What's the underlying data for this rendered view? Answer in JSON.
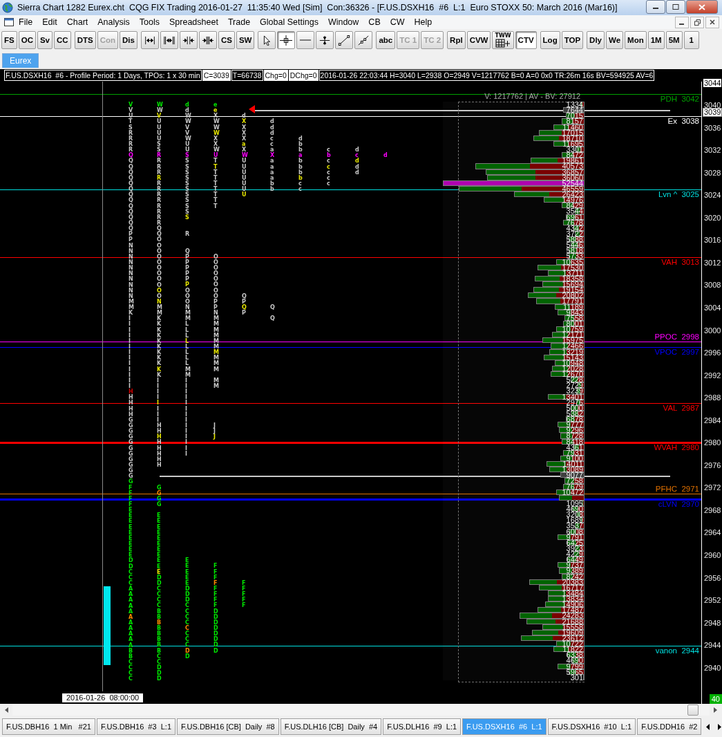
{
  "window": {
    "title": "Sierra Chart 1282 Eurex.cht  CQG FIX Trading 2016-01-27  11:35:40 Wed [Sim]  Con:36326 - [F.US.DSXH16  #6  L:1  Euro STOXX 50: March 2016 (Mar16)]"
  },
  "menu": [
    "File",
    "Edit",
    "Chart",
    "Analysis",
    "Tools",
    "Spreadsheet",
    "Trade",
    "Global Settings",
    "Window",
    "CB",
    "CW",
    "Help"
  ],
  "toolbar": [
    [
      {
        "kind": "text",
        "label": "FS",
        "selected": false,
        "disabled": false
      },
      {
        "kind": "text",
        "label": "OC",
        "selected": false,
        "disabled": false
      },
      {
        "kind": "text",
        "label": "Sv",
        "selected": false,
        "disabled": false
      },
      {
        "kind": "text",
        "label": "CC",
        "selected": false,
        "disabled": false
      }
    ],
    [
      {
        "kind": "text",
        "label": "DTS",
        "selected": false,
        "disabled": false
      },
      {
        "kind": "text",
        "label": "Con",
        "selected": false,
        "disabled": true
      },
      {
        "kind": "text",
        "label": "Dis",
        "selected": false,
        "disabled": false
      }
    ],
    [
      {
        "kind": "icon",
        "selected": false
      },
      {
        "kind": "icon",
        "selected": false
      },
      {
        "kind": "icon",
        "selected": false
      },
      {
        "kind": "icon",
        "selected": false
      },
      {
        "kind": "text",
        "label": "CS",
        "selected": false,
        "disabled": false
      },
      {
        "kind": "text",
        "label": "SW",
        "selected": false,
        "disabled": false
      }
    ],
    [
      {
        "kind": "icon",
        "selected": false
      },
      {
        "kind": "icon",
        "selected": true
      },
      {
        "kind": "icon",
        "selected": false
      },
      {
        "kind": "icon",
        "selected": false
      },
      {
        "kind": "icon",
        "selected": false
      },
      {
        "kind": "icon",
        "selected": false
      }
    ],
    [
      {
        "kind": "text",
        "label": "abc",
        "selected": false,
        "disabled": false
      },
      {
        "kind": "text",
        "label": "TC 1",
        "selected": false,
        "disabled": true
      },
      {
        "kind": "text",
        "label": "TC 2",
        "selected": false,
        "disabled": true
      }
    ],
    [
      {
        "kind": "text",
        "label": "Rpl",
        "selected": false,
        "disabled": false
      },
      {
        "kind": "text",
        "label": "CVW",
        "selected": false,
        "disabled": false
      },
      {
        "kind": "grid",
        "label": "TWW",
        "selected": false
      },
      {
        "kind": "text",
        "label": "CTV",
        "selected": true,
        "disabled": false
      }
    ],
    [
      {
        "kind": "text",
        "label": "Log",
        "selected": false,
        "disabled": false
      },
      {
        "kind": "text",
        "label": "TOP",
        "selected": false,
        "disabled": false
      }
    ],
    [
      {
        "kind": "text",
        "label": "Dly",
        "selected": false,
        "disabled": false
      },
      {
        "kind": "text",
        "label": "We",
        "selected": false,
        "disabled": false
      },
      {
        "kind": "text",
        "label": "Mon",
        "selected": false,
        "disabled": false
      },
      {
        "kind": "text",
        "label": "1M",
        "selected": false,
        "disabled": false
      },
      {
        "kind": "text",
        "label": "5M",
        "selected": false,
        "disabled": false
      },
      {
        "kind": "text",
        "label": "1",
        "selected": false,
        "disabled": false
      }
    ]
  ],
  "chartbook_tabs": [
    {
      "label": "Eurex",
      "selected": true
    }
  ],
  "info_bar": [
    {
      "text": "F.US.DSXH16  #6 - Profile Period: 1 Days, TPOs: 1 x 30 min",
      "boxed": false
    },
    {
      "text": "C=3039",
      "boxed": true
    },
    {
      "text": "T=66738",
      "boxed": false
    },
    {
      "text": "Chg=0",
      "boxed": true
    },
    {
      "text": "DChg=0",
      "boxed": true
    },
    {
      "text": "2016-01-26 22:03:44 H=3040 L=2938 O=2949 V=1217762 B=0 A=0 0x0 TR:26m 16s BV=594925 AV=6",
      "boxed": false
    }
  ],
  "tpo_columns": [
    [
      {
        "kind": "green",
        "text": "V"
      },
      {
        "kind": "grey",
        "text": "VUTSRRRR"
      },
      {
        "kind": "magenta",
        "text": "Q"
      },
      {
        "kind": "grey",
        "text": "QQQQQQQQQQQQQPPNNNNNNNNNNMMKIIIIIIIIIIIII"
      },
      {
        "kind": "red",
        "text": "H"
      },
      {
        "kind": "grey",
        "text": "HHHHGGGGGGGGGGG"
      },
      {
        "kind": "green",
        "text": "GFFFFEEEEEEEEEDDCCCAAAAA"
      },
      {
        "kind": "orange",
        "text": "A"
      },
      {
        "kind": "green",
        "text": "AAAAABBCCCC"
      }
    ],
    [
      {
        "kind": "green",
        "text": "W"
      },
      {
        "kind": "grey",
        "text": "W"
      },
      {
        "kind": "yellow",
        "text": "V"
      },
      {
        "kind": "grey",
        "text": "UUUUSS"
      },
      {
        "kind": "magenta",
        "text": "R"
      },
      {
        "kind": "grey",
        "text": "RRR"
      },
      {
        "kind": "yellow",
        "text": "R"
      },
      {
        "kind": "grey",
        "text": "RRRRRRRRQQOOOOOOOOO"
      },
      {
        "kind": "yellow",
        "text": "O"
      },
      {
        "kind": "grey",
        "text": "O"
      },
      {
        "kind": "yellow",
        "text": "N"
      },
      {
        "kind": "grey",
        "text": "MMKKKKKKKKK"
      },
      {
        "kind": "yellow",
        "text": "K"
      },
      {
        "kind": "grey",
        "text": "KIIII"
      },
      {
        "kind": "yellow",
        "text": "I"
      },
      {
        "kind": "grey",
        "text": "IIIHH"
      },
      {
        "kind": "yellow",
        "text": "H"
      },
      {
        "kind": "grey",
        "text": "HHHHH"
      },
      {
        "kind": "gap",
        "text": "   "
      },
      {
        "kind": "green",
        "text": "G"
      },
      {
        "kind": "orange",
        "text": "G"
      },
      {
        "kind": "green",
        "text": "GG"
      },
      {
        "kind": "gap",
        "text": " "
      },
      {
        "kind": "green",
        "text": "EEEEEEEEEE"
      },
      {
        "kind": "yellow",
        "text": "E"
      },
      {
        "kind": "green",
        "text": "DDCCCCBB"
      },
      {
        "kind": "orange",
        "text": "B"
      },
      {
        "kind": "green",
        "text": "BBBBBCCDDD"
      }
    ],
    [
      {
        "kind": "green",
        "text": "d"
      },
      {
        "kind": "grey",
        "text": "dWWVVWUU"
      },
      {
        "kind": "magenta",
        "text": "S"
      },
      {
        "kind": "grey",
        "text": "SSSSSSSSSS"
      },
      {
        "kind": "yellow",
        "text": "S"
      },
      {
        "kind": "gap",
        "text": "  "
      },
      {
        "kind": "grey",
        "text": "R"
      },
      {
        "kind": "gap",
        "text": "  "
      },
      {
        "kind": "grey",
        "text": "QPPPPP"
      },
      {
        "kind": "yellow",
        "text": "P"
      },
      {
        "kind": "grey",
        "text": "OOONMMLLL"
      },
      {
        "kind": "yellow",
        "text": "L"
      },
      {
        "kind": "grey",
        "text": "LLLLMMIIIIIIIIIIIIII"
      },
      {
        "kind": "gap",
        "text": "                  "
      },
      {
        "kind": "green",
        "text": "EEEEEDDDCCCC"
      },
      {
        "kind": "orange",
        "text": "C"
      },
      {
        "kind": "green",
        "text": "CCC"
      },
      {
        "kind": "orange",
        "text": "D"
      },
      {
        "kind": "green",
        "text": "D"
      }
    ],
    [
      {
        "kind": "green",
        "text": "e"
      },
      {
        "kind": "yellow",
        "text": "e"
      },
      {
        "kind": "grey",
        "text": "XWW"
      },
      {
        "kind": "yellow",
        "text": "W"
      },
      {
        "kind": "grey",
        "text": "XXW"
      },
      {
        "kind": "magenta",
        "text": "U"
      },
      {
        "kind": "grey",
        "text": "T"
      },
      {
        "kind": "yellow",
        "text": "T"
      },
      {
        "kind": "grey",
        "text": "TTTTTTT"
      },
      {
        "kind": "gap",
        "text": "        "
      },
      {
        "kind": "grey",
        "text": "OOOOOOOOPPNMMMMMM"
      },
      {
        "kind": "yellow",
        "text": "M"
      },
      {
        "kind": "grey",
        "text": "MMM"
      },
      {
        "kind": "gap",
        "text": " "
      },
      {
        "kind": "grey",
        "text": "MM"
      },
      {
        "kind": "gap",
        "text": "      "
      },
      {
        "kind": "grey",
        "text": "JJ"
      },
      {
        "kind": "yellow",
        "text": "J"
      },
      {
        "kind": "gap",
        "text": "                      "
      },
      {
        "kind": "green",
        "text": "FFF"
      },
      {
        "kind": "orange",
        "text": "F"
      },
      {
        "kind": "green",
        "text": "FFFFDDDDDDDD"
      }
    ],
    [
      {
        "kind": "gap",
        "text": "  "
      },
      {
        "kind": "grey",
        "text": "d"
      },
      {
        "kind": "yellow",
        "text": "X"
      },
      {
        "kind": "grey",
        "text": "XXX"
      },
      {
        "kind": "yellow",
        "text": "a"
      },
      {
        "kind": "grey",
        "text": "X"
      },
      {
        "kind": "magenta",
        "text": "W"
      },
      {
        "kind": "grey",
        "text": "UUUUUU"
      },
      {
        "kind": "yellow",
        "text": "U"
      },
      {
        "kind": "gap",
        "text": "                 "
      },
      {
        "kind": "grey",
        "text": "QP"
      },
      {
        "kind": "yellow",
        "text": "Q"
      },
      {
        "kind": "grey",
        "text": "P"
      },
      {
        "kind": "gap",
        "text": "                                               "
      },
      {
        "kind": "green",
        "text": "FFFFF"
      }
    ],
    [
      {
        "kind": "gap",
        "text": "   "
      },
      {
        "kind": "grey",
        "text": "dddcca"
      },
      {
        "kind": "magenta",
        "text": "X"
      },
      {
        "kind": "grey",
        "text": "aaaabb"
      },
      {
        "kind": "gap",
        "text": "                    "
      },
      {
        "kind": "grey",
        "text": "Q"
      },
      {
        "kind": "gap",
        "text": " "
      },
      {
        "kind": "grey",
        "text": "Q"
      }
    ],
    [
      {
        "kind": "gap",
        "text": "      "
      },
      {
        "kind": "grey",
        "text": "dbb"
      },
      {
        "kind": "magenta",
        "text": "a"
      },
      {
        "kind": "grey",
        "text": "bbb"
      },
      {
        "kind": "yellow",
        "text": "b"
      },
      {
        "kind": "grey",
        "text": "cc"
      }
    ],
    [
      {
        "kind": "gap",
        "text": "        "
      },
      {
        "kind": "grey",
        "text": "c"
      },
      {
        "kind": "magenta",
        "text": "b"
      },
      {
        "kind": "grey",
        "text": "c"
      },
      {
        "kind": "yellow",
        "text": "c"
      },
      {
        "kind": "grey",
        "text": "ccc"
      }
    ],
    [
      {
        "kind": "gap",
        "text": "        "
      },
      {
        "kind": "grey",
        "text": "d"
      },
      {
        "kind": "magenta",
        "text": "c"
      },
      {
        "kind": "yellow",
        "text": "d"
      },
      {
        "kind": "grey",
        "text": "dd"
      }
    ],
    [
      {
        "kind": "gap",
        "text": "         "
      },
      {
        "kind": "magenta",
        "text": "d"
      }
    ]
  ],
  "profile": {
    "title": "V: 1217762 | AV - BV: 27912",
    "rows": [
      {
        "volume": "1334",
        "kind": "normal",
        "level": 0.03
      },
      {
        "volume": "7644",
        "kind": "last",
        "level": 0.15
      },
      {
        "volume": "7015",
        "kind": "normal",
        "level": 0.13
      },
      {
        "volume": "8157",
        "kind": "normal",
        "level": 0.16
      },
      {
        "volume": "11460",
        "kind": "normal",
        "level": 0.22
      },
      {
        "volume": "17015",
        "kind": "normal",
        "level": 0.32
      },
      {
        "volume": "18710",
        "kind": "normal",
        "level": 0.36
      },
      {
        "volume": "11695",
        "kind": "normal",
        "level": 0.22
      },
      {
        "volume": "3301",
        "kind": "normal",
        "level": 0.06
      },
      {
        "volume": "8472",
        "kind": "normal",
        "level": 0.16
      },
      {
        "volume": "19861",
        "kind": "normal",
        "level": 0.38
      },
      {
        "volume": "40573",
        "kind": "normal",
        "level": 0.77
      },
      {
        "volume": "36857",
        "kind": "normal",
        "level": 0.7
      },
      {
        "volume": "36060",
        "kind": "normal",
        "level": 0.69
      },
      {
        "volume": "52544",
        "kind": "poc",
        "level": 1
      },
      {
        "volume": "46559",
        "kind": "normal",
        "level": 0.89
      },
      {
        "volume": "26423",
        "kind": "normal",
        "level": 0.5
      },
      {
        "volume": "14976",
        "kind": "normal",
        "level": 0.29
      },
      {
        "volume": "8429",
        "kind": "normal",
        "level": 0.16
      },
      {
        "volume": "3544",
        "kind": "normal",
        "level": 0.07
      },
      {
        "volume": "6961",
        "kind": "normal",
        "level": 0.13
      },
      {
        "volume": "7678",
        "kind": "normal",
        "level": 0.15
      },
      {
        "volume": "4342",
        "kind": "normal",
        "level": 0.08
      },
      {
        "volume": "3722",
        "kind": "normal",
        "level": 0.07
      },
      {
        "volume": "5888",
        "kind": "normal",
        "level": 0.11
      },
      {
        "volume": "5446",
        "kind": "normal",
        "level": 0.1
      },
      {
        "volume": "5818",
        "kind": "normal",
        "level": 0.11
      },
      {
        "volume": "5733",
        "kind": "normal",
        "level": 0.11
      },
      {
        "volume": "10635",
        "kind": "normal",
        "level": 0.2
      },
      {
        "volume": "17530",
        "kind": "normal",
        "level": 0.33
      },
      {
        "volume": "13711",
        "kind": "normal",
        "level": 0.26
      },
      {
        "volume": "18358",
        "kind": "normal",
        "level": 0.35
      },
      {
        "volume": "15694",
        "kind": "normal",
        "level": 0.3
      },
      {
        "volume": "19154",
        "kind": "normal",
        "level": 0.36
      },
      {
        "volume": "20802",
        "kind": "normal",
        "level": 0.4
      },
      {
        "volume": "17791",
        "kind": "normal",
        "level": 0.34
      },
      {
        "volume": "11189",
        "kind": "normal",
        "level": 0.21
      },
      {
        "volume": "9843",
        "kind": "normal",
        "level": 0.19
      },
      {
        "volume": "7558",
        "kind": "normal",
        "level": 0.14
      },
      {
        "volume": "8001",
        "kind": "normal",
        "level": 0.15
      },
      {
        "volume": "10759",
        "kind": "normal",
        "level": 0.2
      },
      {
        "volume": "12171",
        "kind": "normal",
        "level": 0.23
      },
      {
        "volume": "15975",
        "kind": "normal",
        "level": 0.3
      },
      {
        "volume": "12466",
        "kind": "normal",
        "level": 0.24
      },
      {
        "volume": "13219",
        "kind": "normal",
        "level": 0.25
      },
      {
        "volume": "15143",
        "kind": "normal",
        "level": 0.29
      },
      {
        "volume": "10948",
        "kind": "normal",
        "level": 0.21
      },
      {
        "volume": "12028",
        "kind": "normal",
        "level": 0.23
      },
      {
        "volume": "12670",
        "kind": "normal",
        "level": 0.24
      },
      {
        "volume": "5228",
        "kind": "normal",
        "level": 0.1
      },
      {
        "volume": "2729",
        "kind": "normal",
        "level": 0.05
      },
      {
        "volume": "3239",
        "kind": "normal",
        "level": 0.06
      },
      {
        "volume": "13401",
        "kind": "normal",
        "level": 0.26
      },
      {
        "volume": "2976",
        "kind": "normal",
        "level": 0.06
      },
      {
        "volume": "5000",
        "kind": "normal",
        "level": 0.1
      },
      {
        "volume": "5382",
        "kind": "normal",
        "level": 0.1
      },
      {
        "volume": "6878",
        "kind": "normal",
        "level": 0.13
      },
      {
        "volume": "9777",
        "kind": "normal",
        "level": 0.19
      },
      {
        "volume": "9296",
        "kind": "normal",
        "level": 0.18
      },
      {
        "volume": "8728",
        "kind": "normal",
        "level": 0.17
      },
      {
        "volume": "8418",
        "kind": "normal",
        "level": 0.16
      },
      {
        "volume": "4361",
        "kind": "normal",
        "level": 0.08
      },
      {
        "volume": "7931",
        "kind": "normal",
        "level": 0.15
      },
      {
        "volume": "9100",
        "kind": "normal",
        "level": 0.17
      },
      {
        "volume": "14011",
        "kind": "normal",
        "level": 0.27
      },
      {
        "volume": "13089",
        "kind": "normal",
        "level": 0.25
      },
      {
        "volume": "9077",
        "kind": "last",
        "level": 0.17
      },
      {
        "volume": "7258",
        "kind": "normal",
        "level": 0.14
      },
      {
        "volume": "7679",
        "kind": "normal",
        "level": 0.15
      },
      {
        "volume": "10472",
        "kind": "normal",
        "level": 0.2
      },
      {
        "kind": "normal",
        "level": 0.18
      },
      {
        "volume": "1095",
        "kind": "normal",
        "level": 0.02
      },
      {
        "volume": "4690",
        "kind": "normal",
        "level": 0.09
      },
      {
        "volume": "3208",
        "kind": "normal",
        "level": 0.06
      },
      {
        "volume": "1689",
        "kind": "normal",
        "level": 0.03
      },
      {
        "volume": "3537",
        "kind": "normal",
        "level": 0.07
      },
      {
        "volume": "6008",
        "kind": "normal",
        "level": 0.11
      },
      {
        "volume": "9791",
        "kind": "normal",
        "level": 0.19
      },
      {
        "volume": "6425",
        "kind": "normal",
        "level": 0.12
      },
      {
        "volume": "3923",
        "kind": "normal",
        "level": 0.07
      },
      {
        "volume": "4229",
        "kind": "normal",
        "level": 0.08
      },
      {
        "volume": "6449",
        "kind": "normal",
        "level": 0.12
      },
      {
        "volume": "9737",
        "kind": "normal",
        "level": 0.19
      },
      {
        "volume": "9389",
        "kind": "normal",
        "level": 0.18
      },
      {
        "volume": "8242",
        "kind": "normal",
        "level": 0.16
      },
      {
        "volume": "20383",
        "kind": "normal",
        "level": 0.39
      },
      {
        "volume": "16717",
        "kind": "normal",
        "level": 0.32
      },
      {
        "volume": "13484",
        "kind": "normal",
        "level": 0.26
      },
      {
        "volume": "13834",
        "kind": "normal",
        "level": 0.26
      },
      {
        "volume": "14906",
        "kind": "normal",
        "level": 0.28
      },
      {
        "volume": "17487",
        "kind": "normal",
        "level": 0.33
      },
      {
        "volume": "24283",
        "kind": "normal",
        "level": 0.46
      },
      {
        "volume": "21688",
        "kind": "normal",
        "level": 0.41
      },
      {
        "volume": "15558",
        "kind": "normal",
        "level": 0.3
      },
      {
        "volume": "19609",
        "kind": "normal",
        "level": 0.37
      },
      {
        "volume": "23612",
        "kind": "normal",
        "level": 0.45
      },
      {
        "volume": "10722",
        "kind": "normal",
        "level": 0.2
      },
      {
        "volume": "11822",
        "kind": "normal",
        "level": 0.22
      },
      {
        "volume": "6338",
        "kind": "normal",
        "level": 0.12
      },
      {
        "volume": "4690",
        "kind": "normal",
        "level": 0.09
      },
      {
        "volume": "9799",
        "kind": "normal",
        "level": 0.19
      },
      {
        "volume": "5965",
        "kind": "normal",
        "level": 0.11
      },
      {
        "volume": "301",
        "kind": "normal",
        "level": 0.01
      }
    ]
  },
  "levels": [
    {
      "label": "PDH",
      "price": "3042",
      "color": "#00a000",
      "kind": "below",
      "thick": false
    },
    {
      "label": "Ex",
      "price": "3038",
      "color": "#ffffff",
      "kind": "below",
      "thick": false
    },
    {
      "label": "Lvn ^",
      "price": "3025",
      "color": "#00e0e0",
      "kind": "below",
      "thick": false
    },
    {
      "label": "VAH",
      "price": "3013",
      "color": "#ff0000",
      "kind": "below",
      "thick": false
    },
    {
      "label": "PPOC",
      "price": "2998",
      "color": "#ff00ff",
      "kind": "above",
      "thick": false
    },
    {
      "label": "VPOC",
      "price": "2997",
      "color": "#0000ff",
      "kind": "below",
      "thick": false
    },
    {
      "label": "VAL",
      "price": "2987",
      "color": "#ff0000",
      "kind": "below",
      "thick": false
    },
    {
      "label": "WVAH",
      "price": "2980",
      "color": "#ff0000",
      "kind": "below",
      "thick": true
    },
    {
      "label": "PFHC",
      "price": "2971",
      "color": "#e07000",
      "kind": "above",
      "thick": false
    },
    {
      "label": "cLVN",
      "price": "2970",
      "color": "#0000ff",
      "kind": "below",
      "thick": true
    },
    {
      "label": "vanon",
      "price": "2944",
      "color": "#00e0e0",
      "kind": "below",
      "thick": false
    }
  ],
  "price_axis": {
    "ticks": [
      {
        "text": "3044",
        "boxed": true
      },
      {
        "text": "3040",
        "boxed": false
      },
      {
        "text": "3036",
        "boxed": false
      },
      {
        "text": "3032",
        "boxed": false
      },
      {
        "text": "3028",
        "boxed": false
      },
      {
        "text": "3024",
        "boxed": false
      },
      {
        "text": "3020",
        "boxed": false
      },
      {
        "text": "3016",
        "boxed": false
      },
      {
        "text": "3012",
        "boxed": false
      },
      {
        "text": "3008",
        "boxed": false
      },
      {
        "text": "3004",
        "boxed": false
      },
      {
        "text": "3000",
        "boxed": false
      },
      {
        "text": "2996",
        "boxed": false
      },
      {
        "text": "2992",
        "boxed": false
      },
      {
        "text": "2988",
        "boxed": false
      },
      {
        "text": "2984",
        "boxed": false
      },
      {
        "text": "2980",
        "boxed": false
      },
      {
        "text": "2976",
        "boxed": false
      },
      {
        "text": "2972",
        "boxed": false
      },
      {
        "text": "2968",
        "boxed": false
      },
      {
        "text": "2964",
        "boxed": false
      },
      {
        "text": "2960",
        "boxed": false
      },
      {
        "text": "2956",
        "boxed": false
      },
      {
        "text": "2952",
        "boxed": false
      },
      {
        "text": "2948",
        "boxed": false
      },
      {
        "text": "2944",
        "boxed": false
      },
      {
        "text": "2940",
        "boxed": false
      }
    ],
    "current": "3039",
    "corner": "40"
  },
  "cursor_date": "2016-01-26  08:00:00",
  "sheet_tabs": [
    {
      "label": "F.US.DBH16  1 Min   #21",
      "selected": false
    },
    {
      "label": "F.US.DBH16  #3  L:1",
      "selected": false
    },
    {
      "label": "F.US.DBH16 [CB]  Daily  #8",
      "selected": false
    },
    {
      "label": "F.US.DLH16 [CB]  Daily  #4",
      "selected": false
    },
    {
      "label": "F.US.DLH16  #9  L:1",
      "selected": false
    },
    {
      "label": "F.US.DSXH16  #6  L:1",
      "selected": true
    },
    {
      "label": "F.US.DSXH16  #10  L:1",
      "selected": false
    },
    {
      "label": "F.US.DDH16  #2",
      "selected": false
    }
  ]
}
